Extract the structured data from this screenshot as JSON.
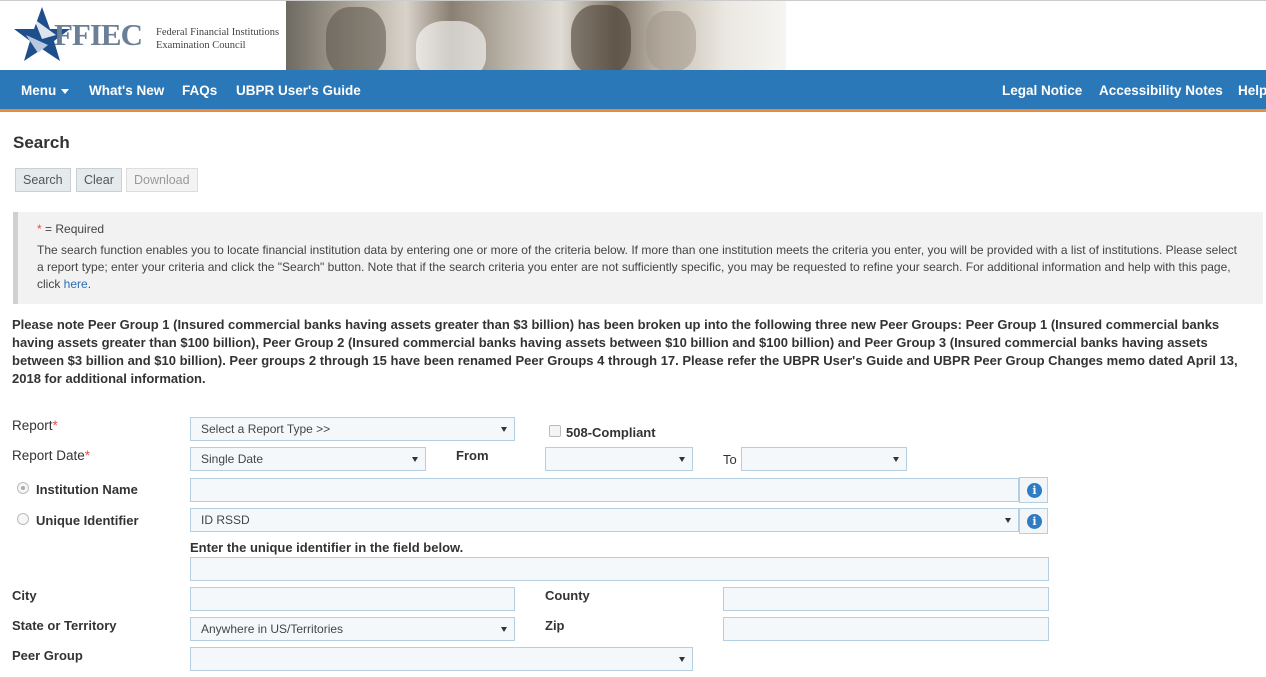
{
  "header": {
    "logo_text": "FFIEC",
    "org_line1": "Federal Financial Institutions",
    "org_line2": "Examination Council"
  },
  "nav": {
    "menu": "Menu",
    "whats_new": "What's New",
    "faqs": "FAQs",
    "user_guide": "UBPR User's Guide",
    "legal": "Legal Notice",
    "accessibility": "Accessibility Notes",
    "help": "Help"
  },
  "page": {
    "title": "Search"
  },
  "toolbar": {
    "search": "Search",
    "clear": "Clear",
    "download": "Download"
  },
  "info": {
    "required_star": "*",
    "required_text": " = Required",
    "desc_line1": "The search function enables you to locate financial institution data by entering one or more of the criteria below. If more than one institution meets the criteria you enter, you will be provided with a list of institutions. Please select",
    "desc_line2": "a report type; enter your criteria and click the \"Search\" button. Note that if the search criteria you enter are not sufficiently specific, you may be requested to refine your search. For additional information and help with this page,",
    "desc_line3_pre": "click ",
    "desc_link": "here",
    "desc_line3_post": "."
  },
  "notice": {
    "line1": "Please note Peer Group 1 (Insured commercial banks having assets greater than $3 billion) has been broken up into the following three new Peer Groups: Peer Group 1 (Insured commercial banks",
    "line2": "having assets greater than $100 billion), Peer Group 2 (Insured commercial banks having assets between $10 billion and $100 billion) and Peer Group 3 (Insured commercial banks having assets",
    "line3": "between $3 billion and $10 billion). Peer groups 2 through 15 have been renamed Peer Groups 4 through 17. Please refer the UBPR User's Guide and UBPR Peer Group Changes memo dated April 13,",
    "line4": "2018 for additional information."
  },
  "form": {
    "report_label": "Report",
    "report_value": "Select a Report Type >>",
    "compliant_label": "508-Compliant",
    "compliant_checked": false,
    "report_date_label": "Report Date",
    "report_date_value": "Single Date",
    "from_label": "From",
    "from_value": "",
    "to_label": "To",
    "to_value": "",
    "institution_label": "Institution Name",
    "institution_value": "",
    "institution_selected": true,
    "unique_label": "Unique Identifier",
    "unique_value": "ID RSSD",
    "unique_selected": false,
    "unique_hint": "Enter the unique identifier in the field below.",
    "unique_input_value": "",
    "city_label": "City",
    "city_value": "",
    "county_label": "County",
    "county_value": "",
    "state_label": "State or Territory",
    "state_value": "Anywhere in US/Territories",
    "zip_label": "Zip",
    "zip_value": "",
    "peer_label": "Peer Group",
    "peer_value": "",
    "required_star": "*",
    "info_icon": "i"
  },
  "colors": {
    "nav_bg": "#2b78b9",
    "nav_accent": "#e98b3a",
    "required": "#d9534f",
    "info_icon": "#2f7bc4",
    "link": "#2a6cb3"
  }
}
